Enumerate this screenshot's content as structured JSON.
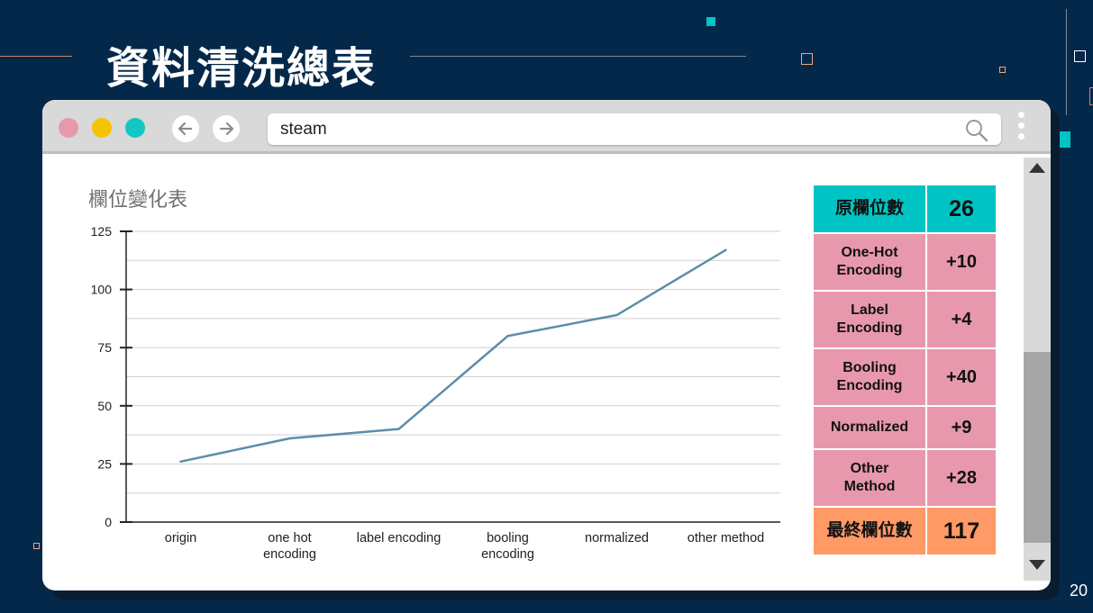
{
  "slide": {
    "title": "資料清洗總表",
    "page_number": "20"
  },
  "browser": {
    "search_text": "steam"
  },
  "chart_data": {
    "type": "line",
    "title": "欄位變化表",
    "categories": [
      "origin",
      "one hot\nencoding",
      "label encoding",
      "booling\nencoding",
      "normalized",
      "other method"
    ],
    "series": [
      {
        "values": [
          26,
          36,
          40,
          80,
          89,
          117
        ]
      }
    ],
    "ylim": [
      0,
      125
    ],
    "yticks": [
      0,
      25,
      50,
      75,
      100,
      125
    ],
    "grid": true,
    "legend": "none",
    "line_color": "#5b8ea8",
    "grid_color": "#d0d0d0"
  },
  "summary_table": {
    "rows": [
      {
        "label": "原欄位數",
        "value": "26",
        "color": "#00c4c4"
      },
      {
        "label": "One-Hot\nEncoding",
        "value": "+10",
        "color": "#e898ad"
      },
      {
        "label": "Label\nEncoding",
        "value": "+4",
        "color": "#e898ad"
      },
      {
        "label": "Booling\nEncoding",
        "value": "+40",
        "color": "#e898ad"
      },
      {
        "label": "Normalized",
        "value": "+9",
        "color": "#e898ad"
      },
      {
        "label": "Other\nMethod",
        "value": "+28",
        "color": "#e898ad"
      },
      {
        "label": "最終欄位數",
        "value": "117",
        "color": "#ff9966"
      }
    ]
  },
  "colors": {
    "background": "#04284a",
    "accent_teal": "#00c4c4",
    "accent_orange": "#f4a582",
    "dot_red": "#e898ad",
    "dot_yellow": "#f5c400",
    "dot_teal": "#12c8c0"
  }
}
